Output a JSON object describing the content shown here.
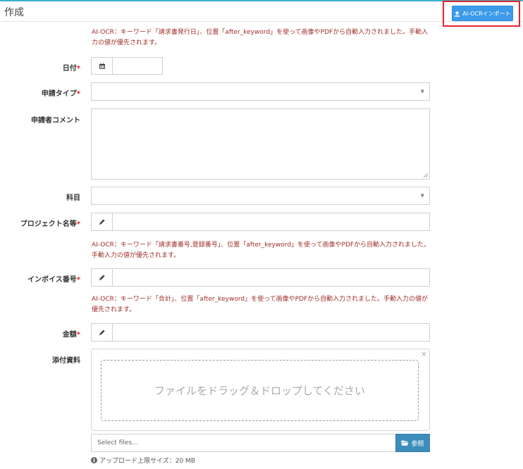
{
  "header": {
    "title": "作成",
    "import_button": "AI-OCRインポート"
  },
  "form": {
    "date": {
      "label": "日付",
      "required": "*",
      "value": ""
    },
    "note_invoice_date": "AI-OCR：キーワード「請求書発行日」、位置「after_keyword」を使って画像やPDFから自動入力されました。手動入力の値が優先されます。",
    "application_type": {
      "label": "申請タイプ",
      "required": "*",
      "value": ""
    },
    "applicant_comment": {
      "label": "申請者コメント",
      "value": ""
    },
    "subject": {
      "label": "科目",
      "value": ""
    },
    "project_name": {
      "label": "プロジェクト名等",
      "required": "*",
      "value": ""
    },
    "note_invoice_number": "AI-OCR：キーワード「請求書番号,登録番号」、位置「after_keyword」を使って画像やPDFから自動入力されました。手動入力の値が優先されます。",
    "invoice_number": {
      "label": "インボイス番号",
      "required": "*",
      "value": ""
    },
    "note_total": "AI-OCR：キーワード「合計」、位置「after_keyword」を使って画像やPDFから自動入力されました。手動入力の値が優先されます。",
    "amount": {
      "label": "金額",
      "required": "*",
      "value": ""
    },
    "attachments": {
      "label": "添付資料",
      "close": "×",
      "drop_text": "ファイルをドラッグ＆ドロップしてください",
      "placeholder": "Select files...",
      "browse_label": "参照",
      "upload_limit": "アップロード上限サイズ：20 MB"
    }
  },
  "colors": {
    "accent": "#3c9be9",
    "browse": "#3c8dbc",
    "note_text": "#a0302a",
    "required": "#d9232d",
    "highlight_border": "#e8222a"
  },
  "icons": {
    "import": "upload-icon",
    "date": "calendar-icon",
    "edit": "pencil-icon",
    "browse": "folder-open-icon",
    "info": "info-icon"
  }
}
